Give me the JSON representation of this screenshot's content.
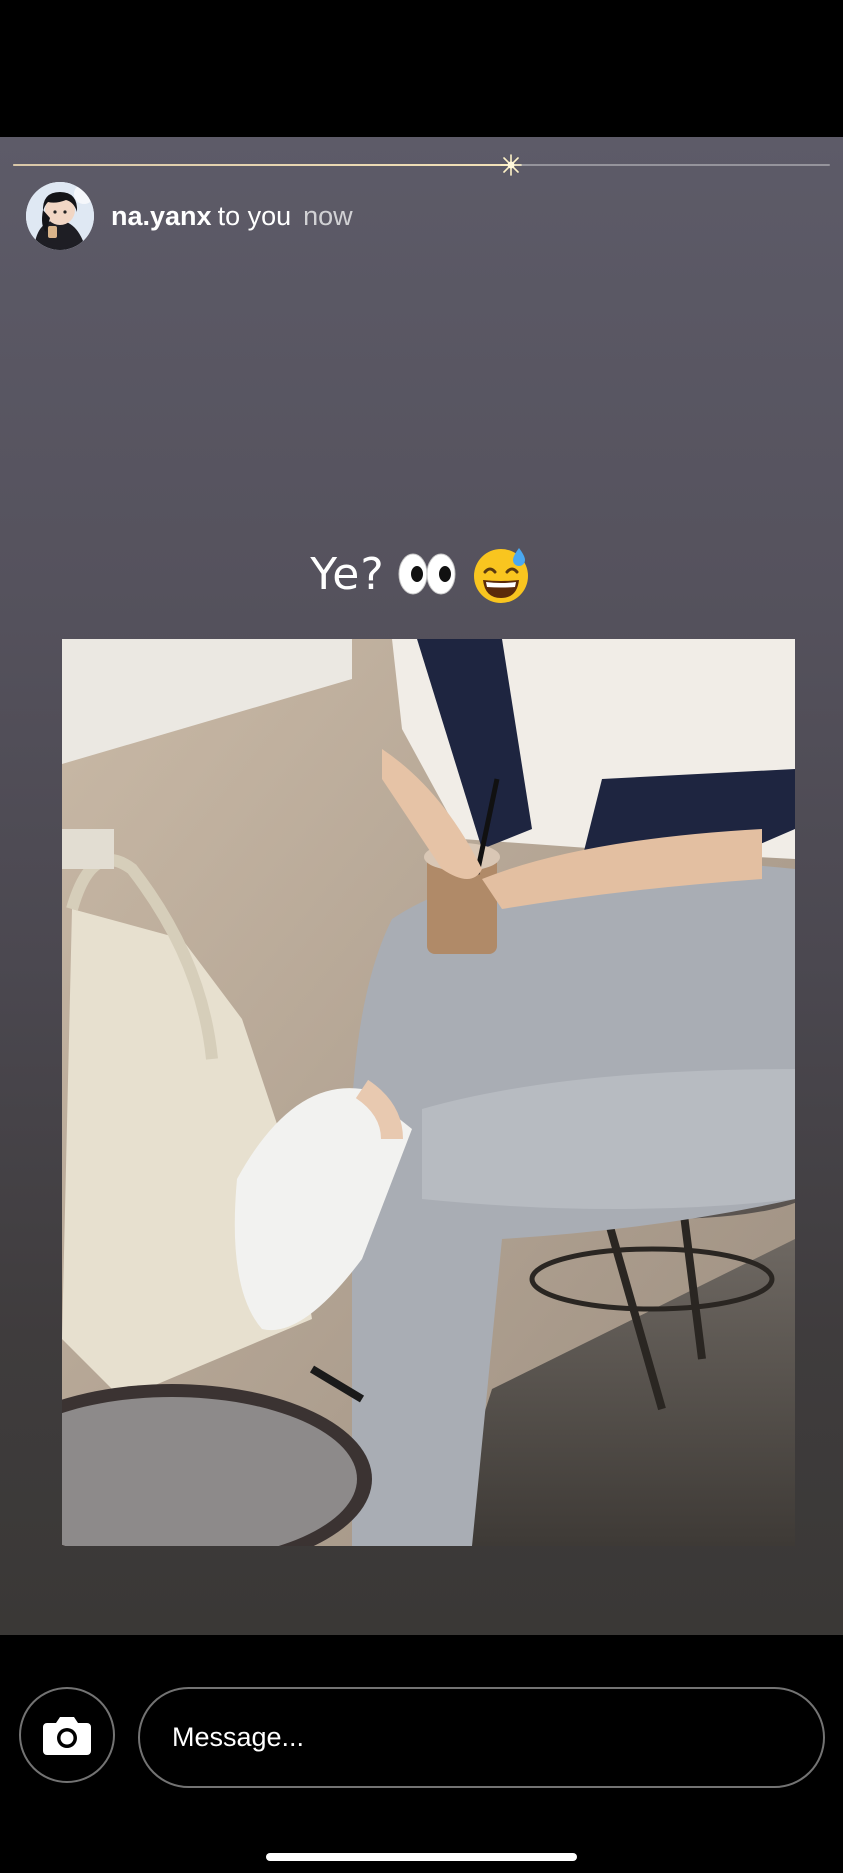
{
  "story": {
    "username": "na.yanx",
    "recipient_text": "to you",
    "timestamp": "now",
    "progress": 0.61,
    "caption": "Ye?",
    "caption_emojis": [
      "eyes-emoji",
      "grinning-sweat-emoji"
    ]
  },
  "composer": {
    "placeholder": "Message...",
    "camera_icon": "camera-icon"
  },
  "colors": {
    "progress_fill": "#f3e2b8",
    "border": "#8a8a8a"
  }
}
